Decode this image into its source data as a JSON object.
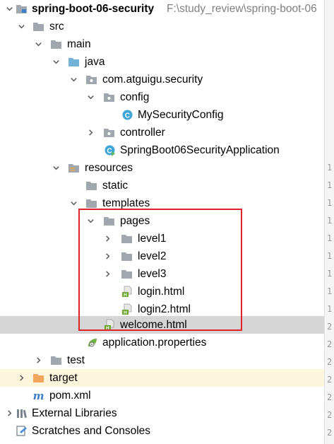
{
  "project": {
    "name": "spring-boot-06-security",
    "path": "F:\\study_review\\spring-boot-06"
  },
  "tree": {
    "src": "src",
    "main": "main",
    "java": "java",
    "pkg": "com.atguigu.security",
    "config": "config",
    "mysecurityconfig": "MySecurityConfig",
    "controller": "controller",
    "app": "SpringBoot06SecurityApplication",
    "resources": "resources",
    "static": "static",
    "templates": "templates",
    "pages": "pages",
    "level1": "level1",
    "level2": "level2",
    "level3": "level3",
    "login": "login.html",
    "login2": "login2.html",
    "welcome": "welcome.html",
    "app_props": "application.properties",
    "test": "test",
    "target": "target",
    "pom": "pom.xml",
    "ext_libs": "External Libraries",
    "scratches": "Scratches and Consoles"
  },
  "gutter": {
    "lines": [
      "1",
      "1",
      "1",
      "1",
      "1",
      "1",
      "1",
      "1",
      "1",
      "2",
      "2",
      "2",
      "2",
      "2",
      "2",
      "2",
      "2"
    ]
  },
  "colors": {
    "folder": "#a0a7ae",
    "folder_blue": "#74b3d8",
    "folder_orange": "#f3a45d",
    "class_icon": "#40a6d8",
    "html_icon": "#6ea52e",
    "highlight_box": "#e0232b"
  }
}
